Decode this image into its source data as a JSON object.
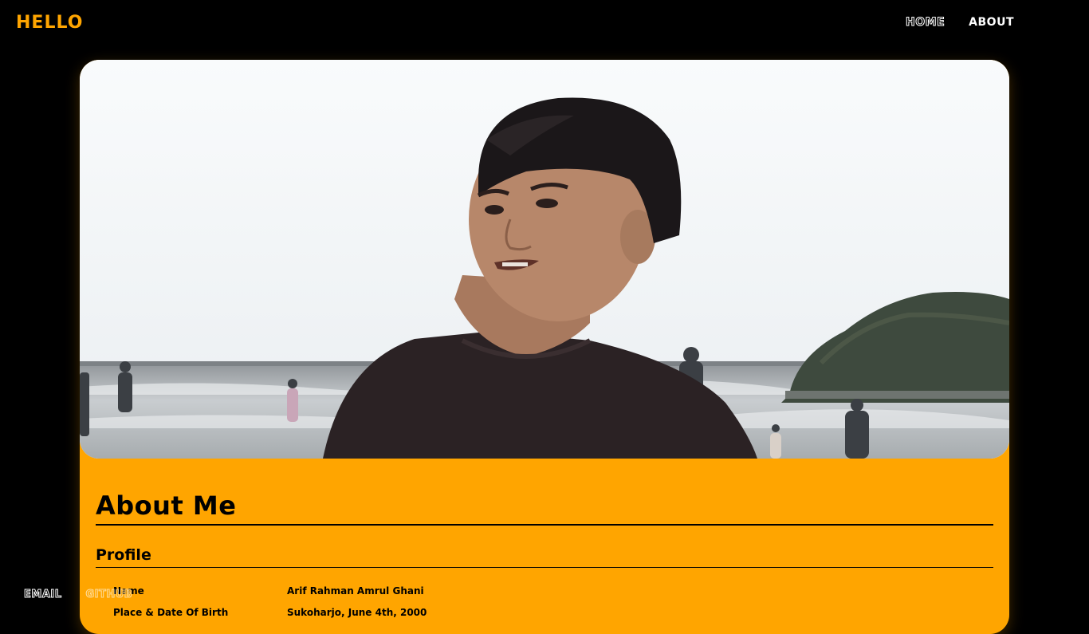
{
  "header": {
    "logo": "HELLO",
    "nav": [
      {
        "label": "HOME"
      },
      {
        "label": "ABOUT"
      }
    ]
  },
  "photo": {
    "description_icon": "profile-photo"
  },
  "about": {
    "title": "About Me",
    "section_title": "Profile",
    "rows": [
      {
        "key": "Name",
        "value": "Arif Rahman Amrul Ghani"
      },
      {
        "key": "Place & Date Of Birth",
        "value": "Sukoharjo, June 4th, 2000"
      }
    ]
  },
  "footer": {
    "email_label": "EMAIL",
    "github_label": "GITHUB"
  },
  "colors": {
    "accent": "#ffa500",
    "background": "#000000",
    "text_light": "#ffffff"
  }
}
